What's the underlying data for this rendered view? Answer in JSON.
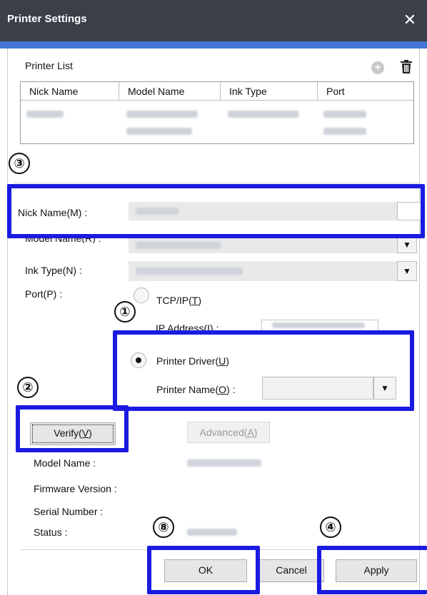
{
  "window": {
    "title": "Printer Settings",
    "close_glyph": "✕"
  },
  "printer_list": {
    "label": "Printer List",
    "add_icon": "plus-circle-icon",
    "delete_icon": "trash-icon",
    "columns": [
      "Nick Name",
      "Model Name",
      "Ink Type",
      "Port"
    ]
  },
  "form": {
    "nick_name_label": "Nick Name(M) :",
    "model_name_label": "Model Name(R) :",
    "ink_type_label": "Ink Type(N) :",
    "port_label": "Port(P) :",
    "tcpip_label": "TCP/IP(T)",
    "ip_address_label": "IP Address(I) :",
    "printer_driver_label": "Printer Driver(U)",
    "printer_name_label": "Printer Name(O) :",
    "port_selected": "Printer Driver"
  },
  "verify": {
    "verify_button": "Verify(V)",
    "advanced_button": "Advanced(A)",
    "model_name_label": "Model Name :",
    "firmware_label": "Firmware Version :",
    "serial_label": "Serial Number :",
    "status_label": "Status :"
  },
  "footer": {
    "ok_button": "OK",
    "cancel_button": "Cancel",
    "apply_button": "Apply"
  },
  "callouts": {
    "c1": "①",
    "c2": "②",
    "c3": "③",
    "c4": "④",
    "c8": "⑧"
  },
  "colors": {
    "titlebar": "#3a3f4a",
    "accent": "#4474d4",
    "callout_border": "#1a1ae0"
  }
}
